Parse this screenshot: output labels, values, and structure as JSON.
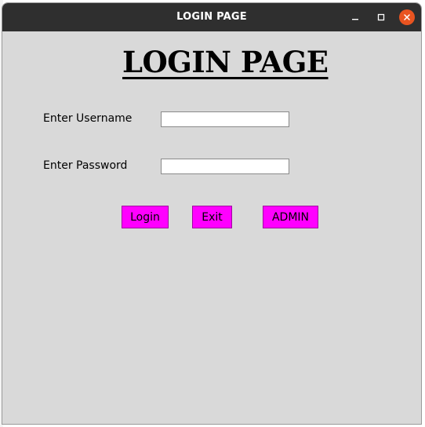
{
  "window": {
    "title": "LOGIN PAGE",
    "controls": {
      "minimize": "minimize-icon",
      "maximize": "maximize-icon",
      "close": "close-icon"
    },
    "close_color": "#e95420",
    "titlebar_color": "#2f2f2f",
    "background_color": "#d9d9d9"
  },
  "form": {
    "heading": "LOGIN PAGE",
    "username_label": "Enter Username",
    "username_value": "",
    "password_label": "Enter Password",
    "password_value": ""
  },
  "buttons": {
    "login_label": "Login",
    "exit_label": "Exit",
    "admin_label": "ADMIN",
    "color": "#ff00ff"
  }
}
